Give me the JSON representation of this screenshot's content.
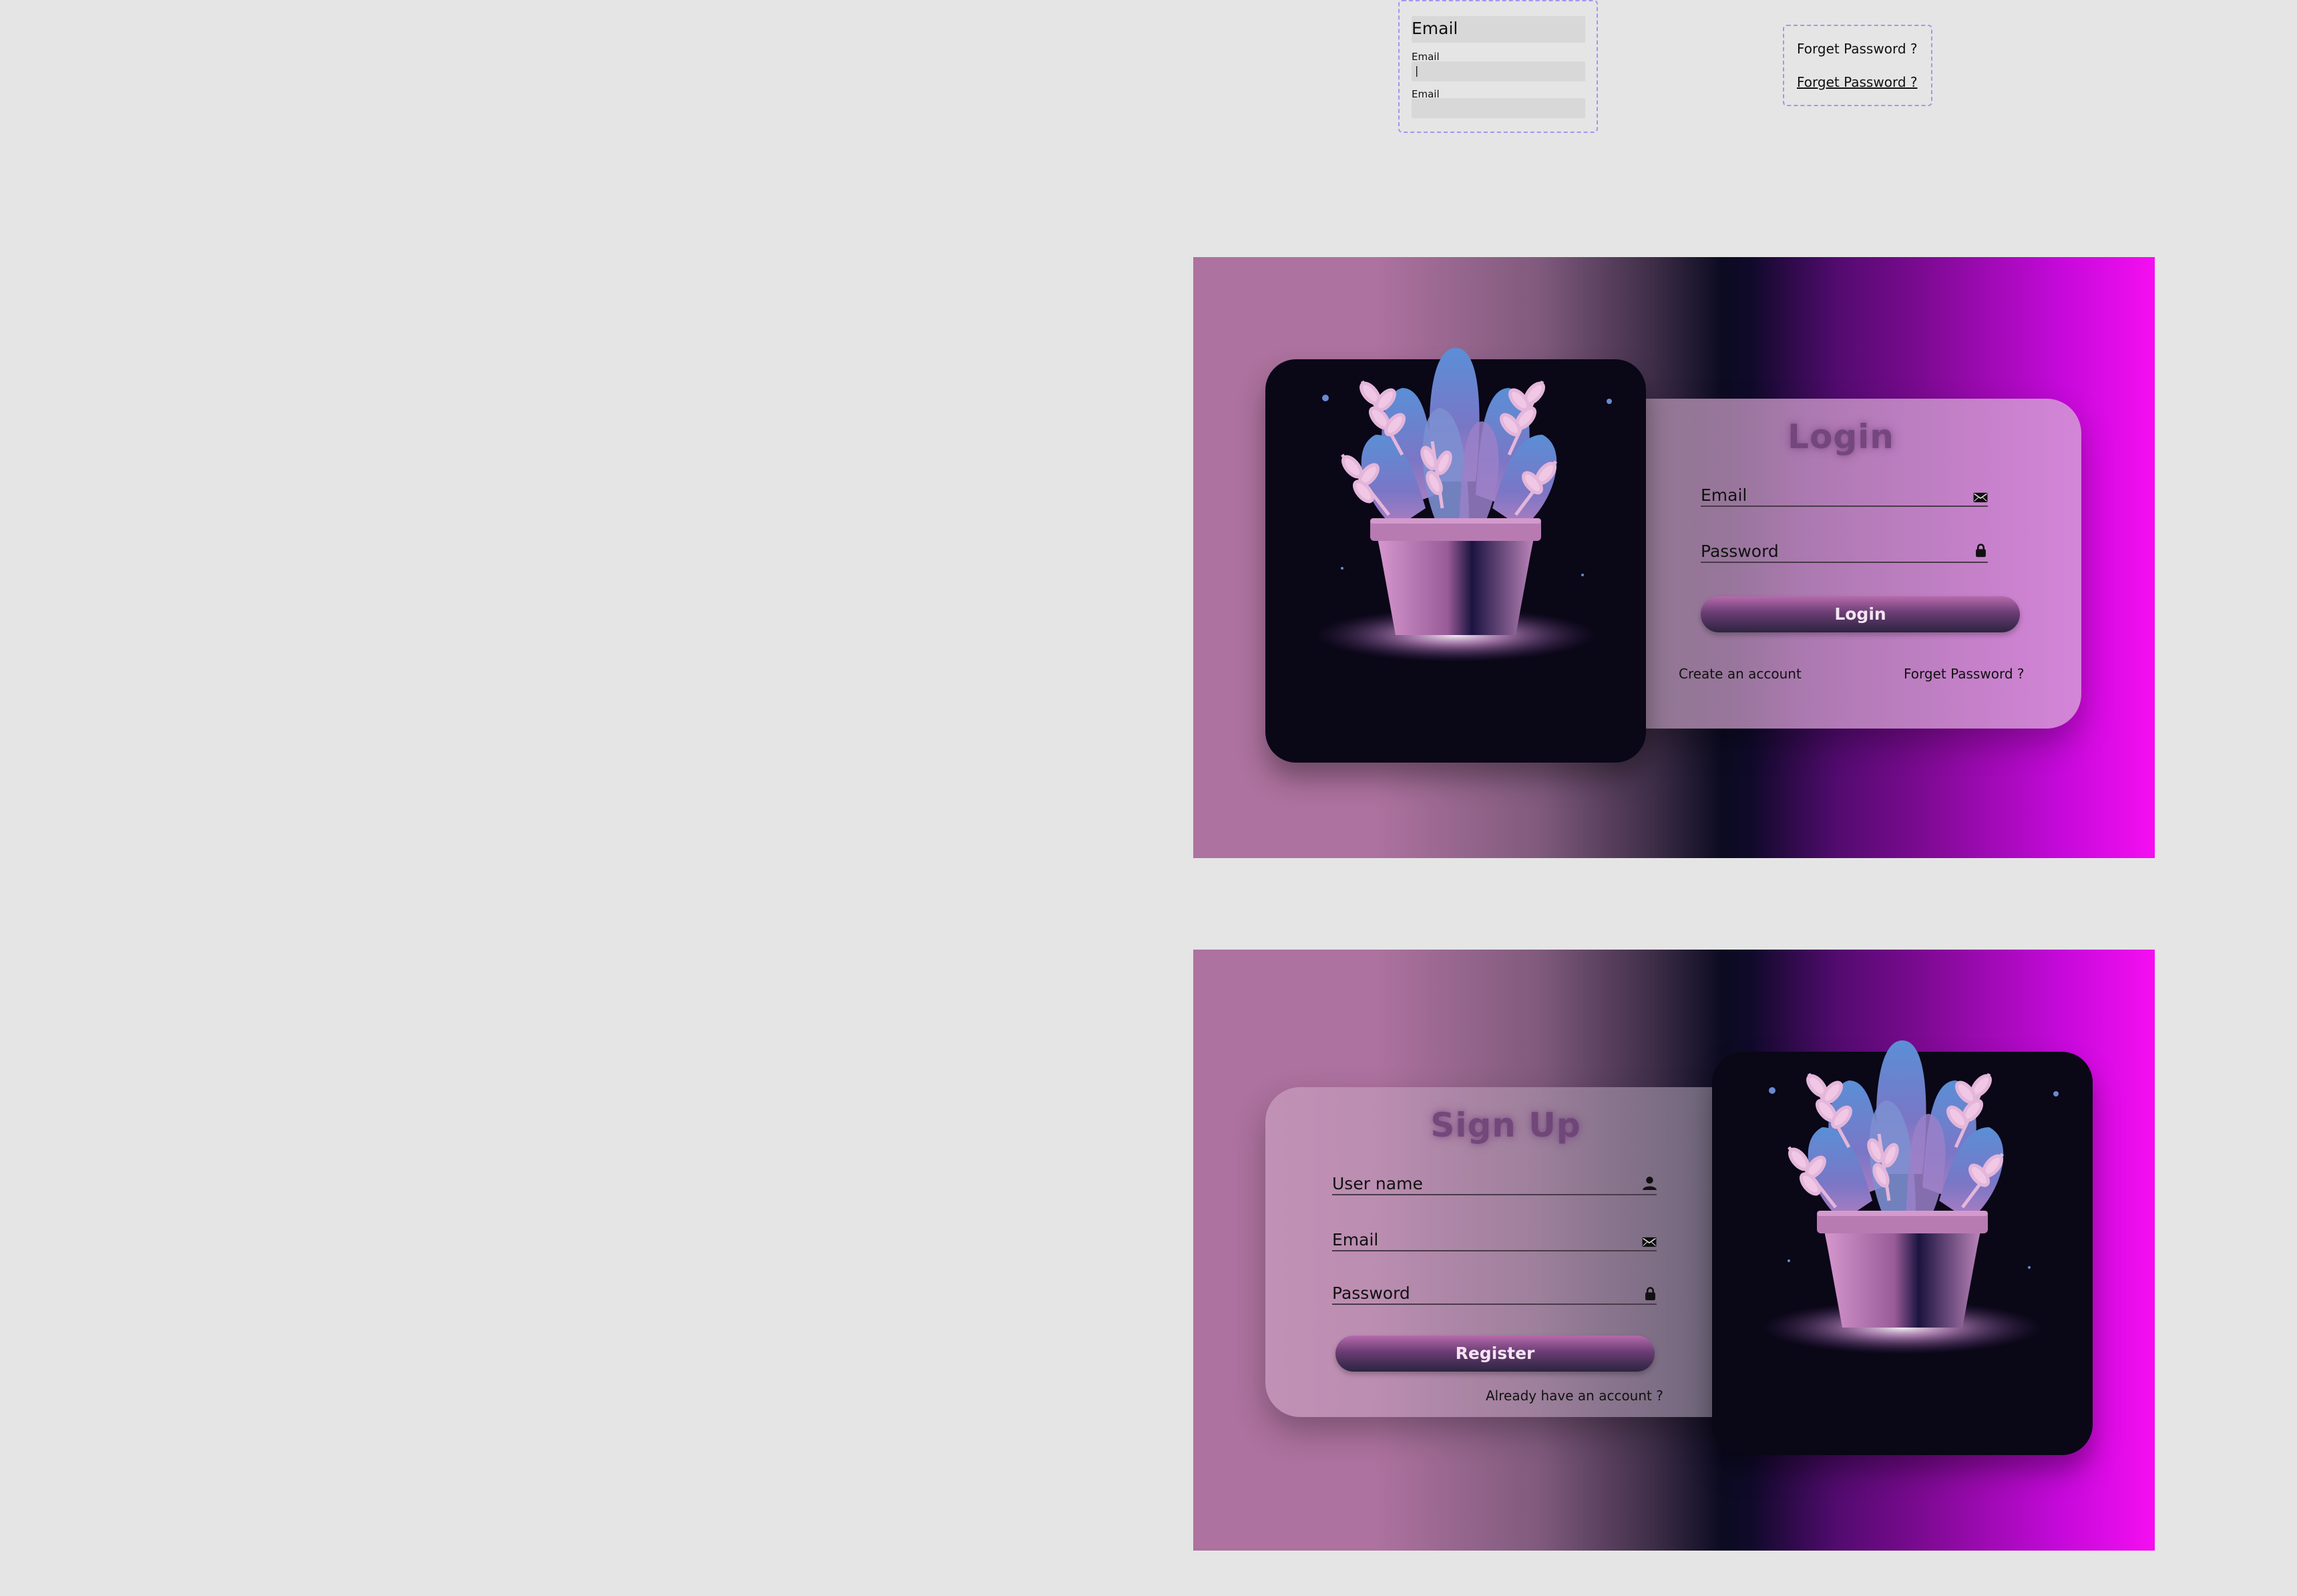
{
  "components": {
    "email_input_title": "Email",
    "email_input_label_1": "Email",
    "email_input_value_1": "|",
    "email_input_label_2": "Email",
    "forget_password_1": "Forget Password ?",
    "forget_password_2": "Forget Password ?"
  },
  "login": {
    "title": "Login",
    "email_label": "Email",
    "password_label": "Password",
    "button_label": "Login",
    "create_account": "Create an account",
    "forget_password": "Forget Password ?"
  },
  "signup": {
    "title": "Sign Up",
    "username_label": "User name",
    "email_label": "Email",
    "password_label": "Password",
    "button_label": "Register",
    "already_account": "Already have an account ?"
  },
  "icons": {
    "email": "mail-icon",
    "password": "lock-icon",
    "username": "user-icon"
  },
  "colors": {
    "gradient_left": "#ad729f",
    "gradient_mid": "#0c0b21",
    "gradient_right": "#f50ef2",
    "image_card_bg": "#0a0717",
    "title_color": "#6a3e74"
  }
}
